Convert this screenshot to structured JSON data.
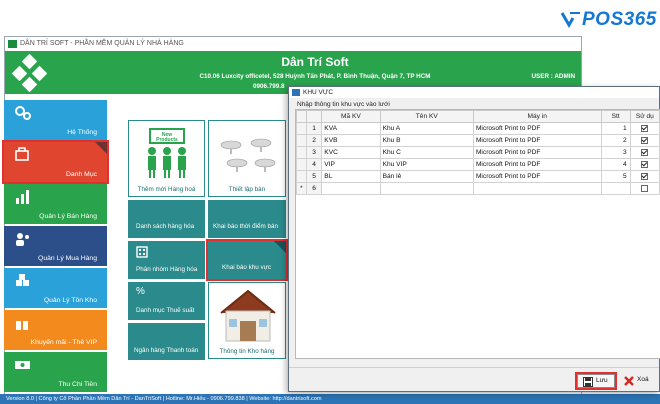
{
  "brand_logo": "POS365",
  "window": {
    "title": "DÂN TRÍ SOFT - PHẦN MỀM QUẢN LÝ NHÀ HÀNG",
    "header_title": "Dân Trí Soft",
    "address": "C10.06 Luxcity officetel, 528 Huỳnh Tấn Phát, P. Bình Thuận, Quận 7, TP HCM",
    "phone": "0906.799.8",
    "user": "USER : ADMIN"
  },
  "nav": [
    {
      "label": "Hệ Thống",
      "icon": "gears-icon",
      "color": "#2aa1d8"
    },
    {
      "label": "Danh Mục",
      "icon": "category-icon",
      "color": "#e0462f"
    },
    {
      "label": "Quản Lý Bán Hàng",
      "icon": "chart-icon",
      "color": "#2aa34d"
    },
    {
      "label": "Quản Lý Mua Hàng",
      "icon": "people-icon",
      "color": "#2c4f8a"
    },
    {
      "label": "Quản Lý Tồn Kho",
      "icon": "boxes-icon",
      "color": "#2aa1d8"
    },
    {
      "label": "Khuyến mãi - Thẻ VIP",
      "icon": "gift-icon",
      "color": "#f28a1e"
    },
    {
      "label": "Thu Chi Tiền",
      "icon": "money-icon",
      "color": "#2aa34d"
    }
  ],
  "tiles": [
    {
      "label": "Thêm mới Hàng hoá",
      "icon": "new-products-icon",
      "sign_text": "New Products"
    },
    {
      "label": "Thiết lập bàn",
      "icon": "tables-icon"
    },
    {
      "label": "Danh sách hàng hóa"
    },
    {
      "label": "Khai báo thời điểm bán"
    },
    {
      "label": "Phân nhóm Hàng hóa",
      "icon": "building-icon"
    },
    {
      "label": "Khai báo khu vực",
      "icon": "area-icon"
    },
    {
      "label": "Danh mục Thuế suất",
      "icon": "percent-icon"
    },
    {
      "label": "Thông tin Kho hàng",
      "icon": "warehouse-icon"
    },
    {
      "label": "Ngân hàng Thanh toán"
    }
  ],
  "status_bar": "Version 8.0   |   Công ty Cổ Phần Phần Mềm Dân Trí - DanTriSoft   |   Hotline: Mr.Hiếu - 0906.799.838   |   Website: http://dantrisoft.com",
  "dialog": {
    "title": "KHU VỰC",
    "group_label": "Nhập thông tin khu vực vào lưới",
    "columns": [
      "Mã KV",
      "Tên KV",
      "Máy in",
      "Stt",
      "Sử dụ"
    ],
    "rows": [
      {
        "rownum": "1",
        "ma": "KVA",
        "ten": "Khu A",
        "may_in": "Microsoft Print to PDF",
        "stt": "1",
        "su_dung": true
      },
      {
        "rownum": "2",
        "ma": "KVB",
        "ten": "Khu B",
        "may_in": "Microsoft Print to PDF",
        "stt": "2",
        "su_dung": true
      },
      {
        "rownum": "3",
        "ma": "KVC",
        "ten": "Khu C",
        "may_in": "Microsoft Print to PDF",
        "stt": "3",
        "su_dung": true
      },
      {
        "rownum": "4",
        "ma": "VIP",
        "ten": "Khu VIP",
        "may_in": "Microsoft Print to PDF",
        "stt": "4",
        "su_dung": true
      },
      {
        "rownum": "5",
        "ma": "BL",
        "ten": "Bán lẻ",
        "may_in": "Microsoft Print to PDF",
        "stt": "5",
        "su_dung": true
      },
      {
        "rownum": "6",
        "ma": "",
        "ten": "",
        "may_in": "",
        "stt": "",
        "su_dung": false,
        "marker": "*"
      }
    ],
    "save_label": "Lưu",
    "delete_label": "Xoá"
  }
}
